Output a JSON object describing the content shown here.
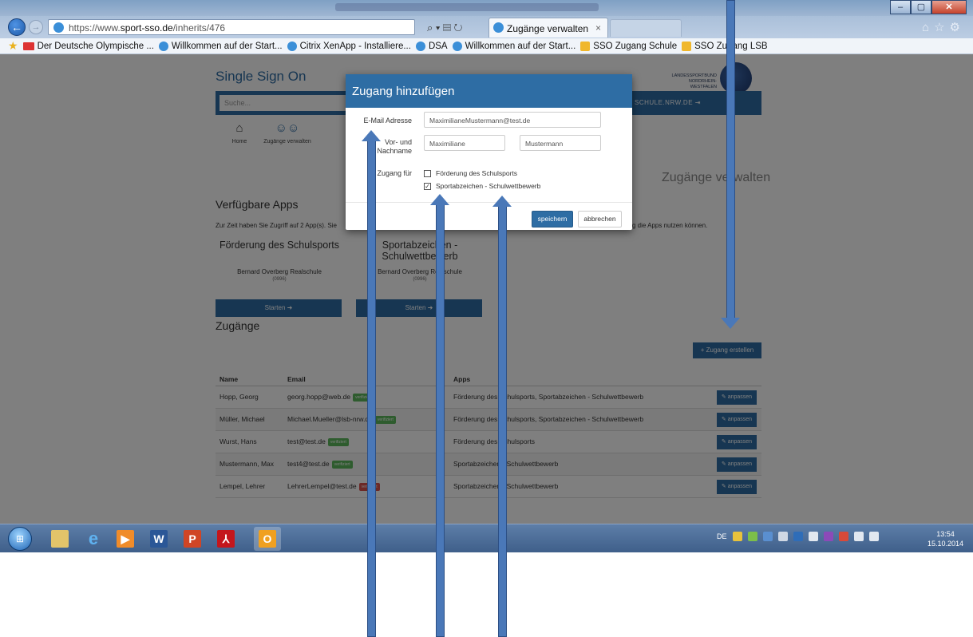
{
  "browser": {
    "url_prefix": "https://www.",
    "url_domain": "sport-sso.de",
    "url_path": "/inherits/476",
    "tab_title": "Zugänge verwalten",
    "tab_close": "×",
    "addr_icons": "⌕ ▾ ▤ ↻",
    "favorites": [
      "Der Deutsche Olympische ...",
      "Willkommen auf der Start...",
      "Citrix XenApp - Installiere...",
      "DSA",
      "Willkommen auf der Start...",
      "SSO Zugang Schule",
      "SSO Zugang LSB"
    ]
  },
  "site": {
    "title": "Single Sign On",
    "logo_text": "LANDESSPORTBUND NORDRHEIN-WESTFALEN",
    "search_placeholder": "Suche...",
    "search_link": "SCHULE.NRW.DE",
    "nav": [
      {
        "label": "Home",
        "icon": "home-icon"
      },
      {
        "label": "Zugänge verwalten",
        "icon": "users-icon"
      }
    ],
    "page_heading": "Zugänge verwalten"
  },
  "apps_section": {
    "title": "Verfügbare Apps",
    "intro": "Zur Zeit haben Sie Zugriff auf 2 App(s). Sie",
    "intro_right": "g die Apps nutzen können.",
    "apps": [
      {
        "name": "Förderung des Schulsports",
        "school": "Bernard Overberg Realschule",
        "code": "(0996)",
        "start": "Starten"
      },
      {
        "name": "Sportabzeichen - Schulwettbewerb",
        "school": "Bernard Overberg Realschule",
        "code": "(0996)",
        "start": "Starten"
      }
    ]
  },
  "access_section": {
    "title": "Zugänge",
    "create_button": "+ Zugang erstellen",
    "columns": {
      "name": "Name",
      "email": "Email",
      "apps": "Apps"
    },
    "rows": [
      {
        "name": "Hopp, Georg",
        "email": "georg.hopp@web.de",
        "badge": "verifiziert",
        "status": "ok",
        "apps": "Förderung des Schulsports, Sportabzeichen - Schulwettbewerb",
        "action": "anpassen"
      },
      {
        "name": "Müller, Michael",
        "email": "Michael.Mueller@lsb-nrw.de",
        "badge": "verifiziert",
        "status": "ok",
        "apps": "Förderung des Schulsports, Sportabzeichen - Schulwettbewerb",
        "action": "anpassen"
      },
      {
        "name": "Wurst, Hans",
        "email": "test@test.de",
        "badge": "verifiziert",
        "status": "ok",
        "apps": "Förderung des Schulsports",
        "action": "anpassen"
      },
      {
        "name": "Mustermann, Max",
        "email": "test4@test.de",
        "badge": "verifiziert",
        "status": "ok",
        "apps": "Sportabzeichen - Schulwettbewerb",
        "action": "anpassen"
      },
      {
        "name": "Lempel, Lehrer",
        "email": "LehrerLempel@test.de",
        "badge": "verifiziert",
        "status": "bad",
        "apps": "Sportabzeichen - Schulwettbewerb",
        "action": "anpassen"
      }
    ]
  },
  "modal": {
    "title": "Zugang hinzufügen",
    "email_label": "E-Mail Adresse",
    "email_value": "MaximilianeMustermann@test.de",
    "name_label_1": "Vor- und",
    "name_label_2": "Nachname",
    "first_name": "Maximiliane",
    "last_name": "Mustermann",
    "access_label": "Zugang für",
    "option_1": "Förderung des Schulsports",
    "option_1_checked": false,
    "option_2": "Sportabzeichen - Schulwettbewerb",
    "option_2_checked": true,
    "check_mark": "✓",
    "save": "speichern",
    "cancel": "abbrechen"
  },
  "taskbar": {
    "lang": "DE",
    "time": "13:54",
    "date": "15.10.2014"
  },
  "colors": {
    "brand_blue": "#2e6da4",
    "verified_green": "#5cb85c",
    "unverified_red": "#d9534f",
    "annotation_arrow": "#4a78b8"
  }
}
